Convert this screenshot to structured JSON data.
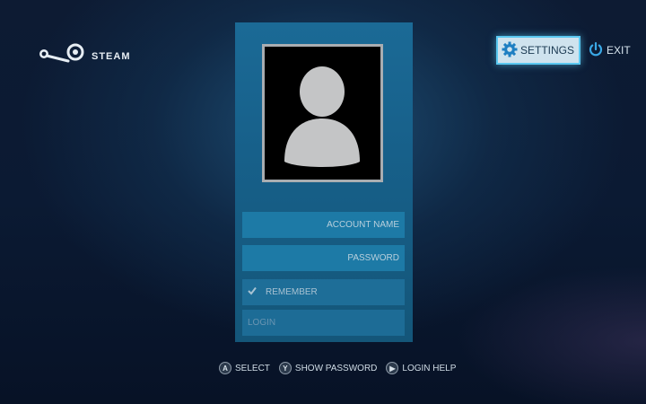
{
  "brand": {
    "logo_text": "STEAM",
    "icon": "steam-logo-icon"
  },
  "top_actions": {
    "settings_label": "SETTINGS",
    "settings_icon": "gear-icon",
    "exit_label": "EXIT",
    "exit_icon": "power-icon",
    "accent_color": "#5ac8f0"
  },
  "login_panel": {
    "avatar_icon": "user-silhouette-icon",
    "account_name_placeholder": "ACCOUNT NAME",
    "password_placeholder": "PASSWORD",
    "remember_label": "REMEMBER",
    "remember_checked": true,
    "login_label": "LOGIN"
  },
  "footer": {
    "hints": [
      {
        "button": "A",
        "label": "SELECT"
      },
      {
        "button": "Y",
        "label": "SHOW PASSWORD"
      },
      {
        "button": "▶",
        "label": "LOGIN HELP"
      }
    ]
  }
}
